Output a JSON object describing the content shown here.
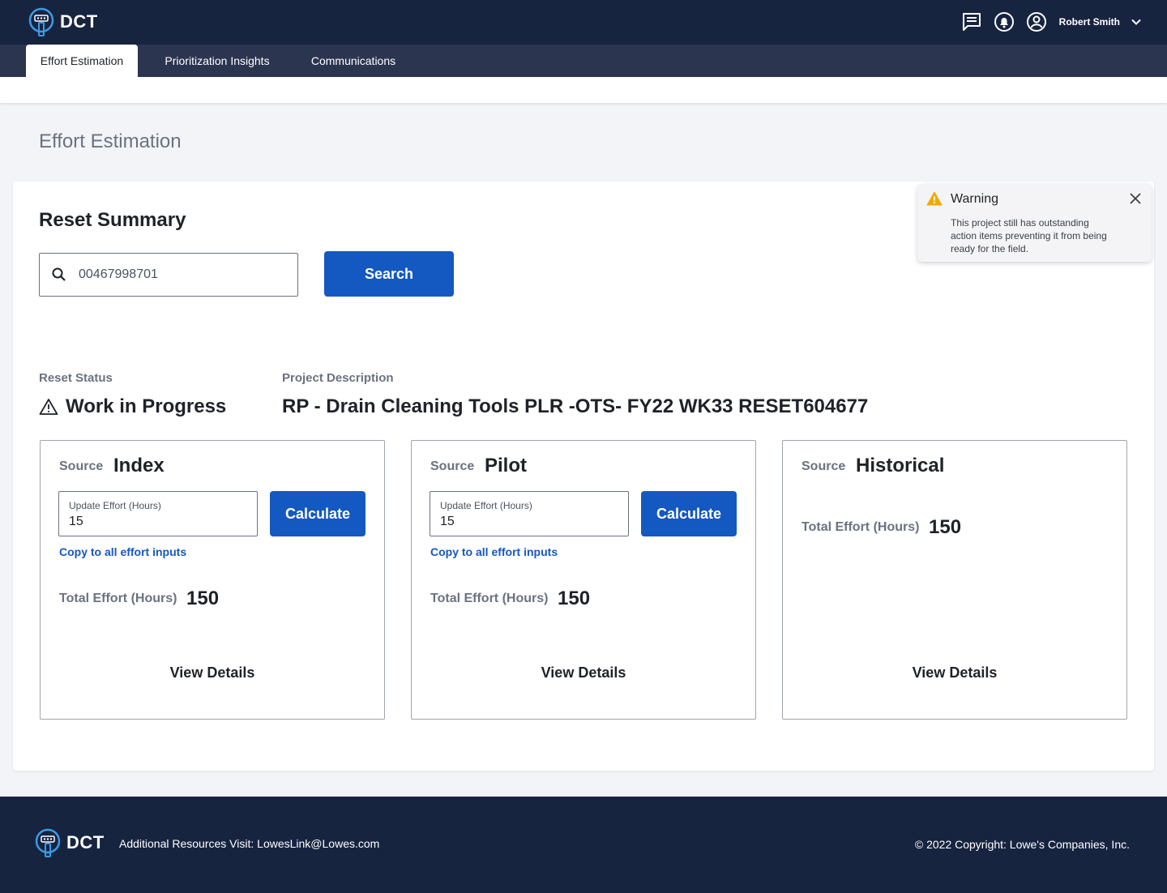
{
  "app": {
    "logo_text": "DCT"
  },
  "header": {
    "user_name": "Robert Smith"
  },
  "tabs": [
    {
      "label": "Effort Estimation",
      "active": true
    },
    {
      "label": "Prioritization Insights",
      "active": false
    },
    {
      "label": "Communications",
      "active": false
    }
  ],
  "page": {
    "title": "Effort Estimation"
  },
  "summary": {
    "title": "Reset Summary",
    "search_value": "00467998701",
    "search_button": "Search",
    "reset_status_label": "Reset Status",
    "reset_status_value": "Work in Progress",
    "project_description_label": "Project Description",
    "project_description_value": "RP - Drain Cleaning Tools PLR -OTS- FY22 WK33 RESET604677"
  },
  "sources": [
    {
      "source_label": "Source",
      "name": "Index",
      "update_label": "Update Effort (Hours)",
      "update_value": "15",
      "calc_button": "Calculate",
      "copy_link": "Copy to all effort inputs",
      "total_label": "Total Effort (Hours)",
      "total_value": "150",
      "view_details": "View Details"
    },
    {
      "source_label": "Source",
      "name": "Pilot",
      "update_label": "Update Effort (Hours)",
      "update_value": "15",
      "calc_button": "Calculate",
      "copy_link": "Copy to all effort inputs",
      "total_label": "Total Effort (Hours)",
      "total_value": "150",
      "view_details": "View Details"
    },
    {
      "source_label": "Source",
      "name": "Historical",
      "total_label": "Total Effort (Hours)",
      "total_value": "150",
      "view_details": "View Details"
    }
  ],
  "toast": {
    "title": "Warning",
    "message": "This project still has outstanding action items preventing it from being ready for the field."
  },
  "footer": {
    "logo_text": "DCT",
    "resources": "Additional Resources Visit: LowesLink@Lowes.com",
    "copyright": "© 2022 Copyright: Lowe's Companies, Inc."
  },
  "colors": {
    "nav_bg": "#172440",
    "tab_bar_bg": "#2c3550",
    "primary": "#1458c2",
    "warning": "#f2a900"
  },
  "icons": [
    "logo-icon",
    "chat-icon",
    "bell-icon",
    "user-circle-icon",
    "chevron-down-icon",
    "search-icon",
    "warning-triangle-icon",
    "warning-filled-icon",
    "close-icon"
  ]
}
